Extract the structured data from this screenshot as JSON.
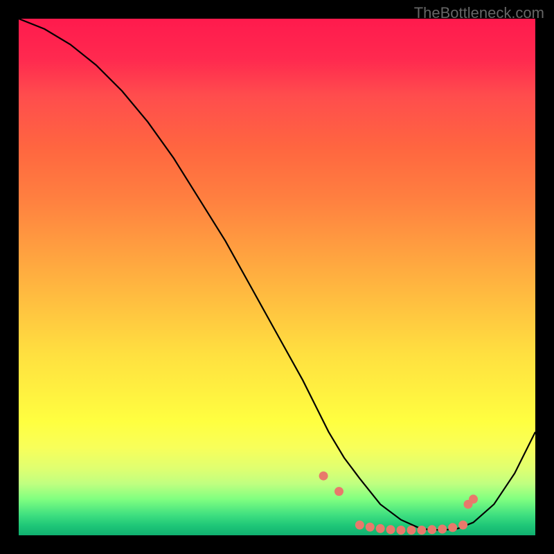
{
  "watermark": "TheBottleneck.com",
  "chart_data": {
    "type": "line",
    "title": "",
    "xlabel": "",
    "ylabel": "",
    "xlim": [
      0,
      100
    ],
    "ylim": [
      0,
      100
    ],
    "grid": false,
    "series": [
      {
        "name": "curve",
        "x": [
          0,
          5,
          10,
          15,
          20,
          25,
          30,
          35,
          40,
          45,
          50,
          55,
          58,
          60,
          63,
          66,
          70,
          74,
          78,
          82,
          85,
          88,
          92,
          96,
          100
        ],
        "values": [
          100,
          98,
          95,
          91,
          86,
          80,
          73,
          65,
          57,
          48,
          39,
          30,
          24,
          20,
          15,
          11,
          6,
          3,
          1.2,
          1,
          1.3,
          2.5,
          6,
          12,
          20
        ]
      }
    ],
    "markers": [
      {
        "x": 59,
        "y": 11.5
      },
      {
        "x": 62,
        "y": 8.5
      },
      {
        "x": 66,
        "y": 2.0
      },
      {
        "x": 68,
        "y": 1.6
      },
      {
        "x": 70,
        "y": 1.3
      },
      {
        "x": 72,
        "y": 1.1
      },
      {
        "x": 74,
        "y": 1.0
      },
      {
        "x": 76,
        "y": 1.0
      },
      {
        "x": 78,
        "y": 1.0
      },
      {
        "x": 80,
        "y": 1.1
      },
      {
        "x": 82,
        "y": 1.2
      },
      {
        "x": 84,
        "y": 1.5
      },
      {
        "x": 86,
        "y": 2.0
      },
      {
        "x": 87,
        "y": 6.0
      },
      {
        "x": 88,
        "y": 7.0
      }
    ],
    "gradient_description": "vertical red-to-yellow-to-green heatmap background"
  }
}
